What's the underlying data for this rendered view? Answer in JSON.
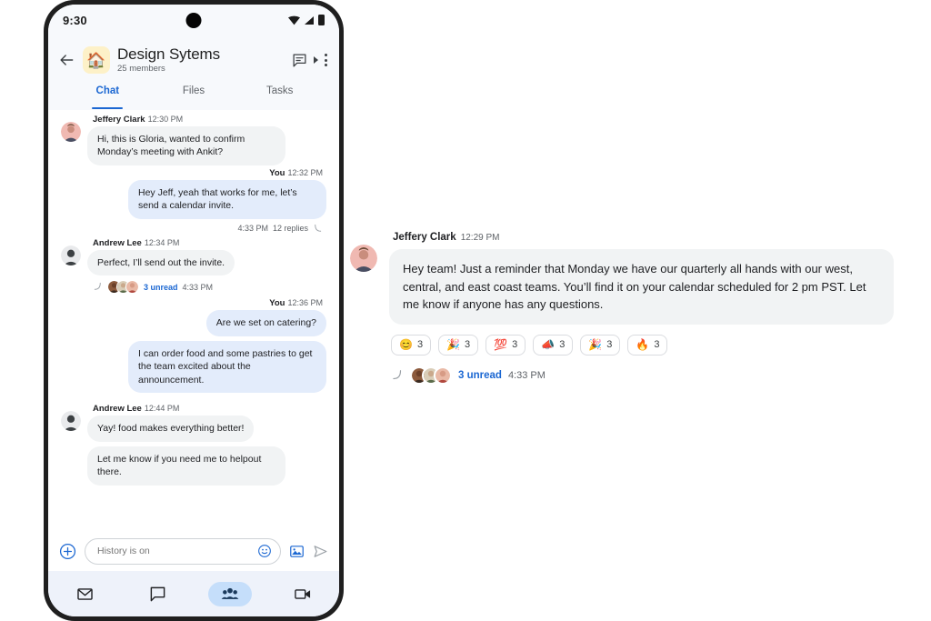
{
  "phone": {
    "status_bar": {
      "time": "9:30",
      "icons": [
        "wifi-icon",
        "cellular-signal-icon",
        "battery-icon"
      ]
    },
    "app_bar": {
      "back_icon": "back-arrow-icon",
      "group_avatar_emoji": "🏠",
      "title": "Design Sytems",
      "subtitle": "25 members",
      "actions": [
        "chat-bubble-icon",
        "expand-caret-icon",
        "overflow-menu-icon"
      ]
    },
    "tabs": [
      {
        "label": "Chat",
        "active": true
      },
      {
        "label": "Files",
        "active": false
      },
      {
        "label": "Tasks",
        "active": false
      }
    ],
    "messages": [
      {
        "sender": "Jeffery Clark",
        "time": "12:30 PM",
        "side": "in",
        "avatar": "jeffery",
        "bubbles": [
          "Hi, this is Gloria, wanted to confirm Monday’s meeting with Ankit?"
        ]
      },
      {
        "sender": "You",
        "time": "12:32 PM",
        "side": "out",
        "bubbles": [
          "Hey Jeff, yeah that works for me, let’s send a calendar invite."
        ],
        "thread": {
          "time": "4:33 PM",
          "replies_label": "12 replies"
        }
      },
      {
        "sender": "Andrew Lee",
        "time": "12:34 PM",
        "side": "in",
        "avatar": "andrew",
        "bubbles": [
          "Perfect, I’ll send out the invite."
        ],
        "thread": {
          "unread_label": "3 unread",
          "time": "4:33 PM"
        }
      },
      {
        "sender": "You",
        "time": "12:36 PM",
        "side": "out",
        "bubbles": [
          "Are we set on catering?",
          "I can order food and some pastries to get the team excited about the announcement."
        ]
      },
      {
        "sender": "Andrew Lee",
        "time": "12:44 PM",
        "side": "in",
        "avatar": "andrew",
        "bubbles": [
          "Yay! food makes everything better!",
          "Let me know if you need me to helpout there."
        ]
      }
    ],
    "composer": {
      "add_icon": "plus-circle-icon",
      "placeholder": "History is on",
      "value": "",
      "emoji_icon": "emoji-smiley-icon",
      "image_icon": "image-attachment-icon",
      "send_icon": "send-icon"
    },
    "bottom_nav": [
      {
        "icon": "mail-icon",
        "active": false
      },
      {
        "icon": "chat-icon",
        "active": false
      },
      {
        "icon": "spaces-people-icon",
        "active": true
      },
      {
        "icon": "meet-video-icon",
        "active": false
      }
    ]
  },
  "detail": {
    "sender": "Jeffery Clark",
    "time": "12:29 PM",
    "avatar": "jeffery",
    "body": "Hey team! Just a reminder that Monday we have our quarterly all hands with our west, central, and east coast teams. You’ll find it on your calendar scheduled for 2 pm PST. Let me know if anyone has any questions.",
    "reactions": [
      {
        "emoji": "😊",
        "name": "smiling-face-reaction",
        "count": "3"
      },
      {
        "emoji": "🎉",
        "name": "party-popper-reaction",
        "count": "3"
      },
      {
        "emoji": "💯",
        "name": "hundred-points-reaction",
        "count": "3"
      },
      {
        "emoji": "📣",
        "name": "megaphone-reaction",
        "count": "3"
      },
      {
        "emoji": "🎉",
        "name": "party-popper-reaction-2",
        "count": "3"
      },
      {
        "emoji": "🔥",
        "name": "fire-reaction",
        "count": "3"
      }
    ],
    "thread": {
      "unread_label": "3 unread",
      "time": "4:33 PM"
    }
  },
  "colors": {
    "accent_blue": "#1b67d2",
    "incoming_bubble": "#f1f3f4",
    "outgoing_bubble": "#e3ecfb",
    "app_bar_bg": "#f7f9fc",
    "bottom_nav_bg": "#eef2fa",
    "active_pill": "#c5defa"
  }
}
